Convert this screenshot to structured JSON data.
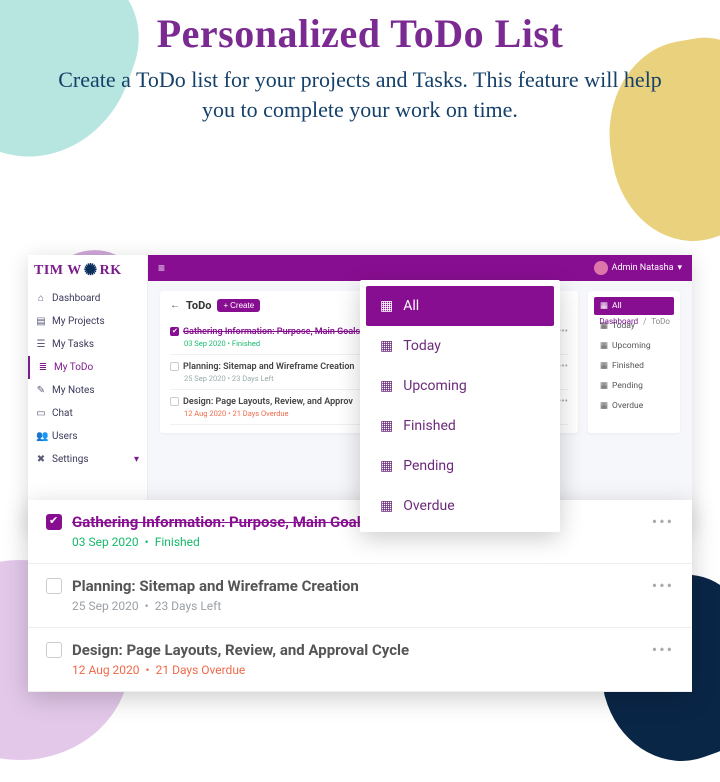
{
  "hero": {
    "title": "Personalized ToDo List",
    "subtitle": "Create a ToDo list for your projects and Tasks. This feature will help you to complete your work on time."
  },
  "brand": {
    "pre": "TIM W",
    "post": "RK"
  },
  "sidebar": {
    "items": [
      {
        "label": "Dashboard"
      },
      {
        "label": "My Projects"
      },
      {
        "label": "My Tasks"
      },
      {
        "label": "My ToDo"
      },
      {
        "label": "My Notes"
      },
      {
        "label": "Chat"
      },
      {
        "label": "Users"
      },
      {
        "label": "Settings"
      }
    ]
  },
  "topbar": {
    "user_name": "Admin Natasha"
  },
  "breadcrumb": {
    "root": "Dashboard",
    "sep": "/",
    "leaf": "ToDo"
  },
  "todo": {
    "heading": "ToDo",
    "create_label": "Create",
    "items": [
      {
        "title": "Gathering Information: Purpose, Main Goals",
        "date": "03 Sep 2020",
        "status": "Finished"
      },
      {
        "title": "Planning: Sitemap and Wireframe Creation",
        "date": "25 Sep 2020",
        "status": "23 Days Left"
      },
      {
        "title": "Design: Page Layouts, Review, and Approv",
        "date": "12 Aug 2020",
        "status": "21 Days Overdue"
      }
    ]
  },
  "filters": {
    "items": [
      {
        "label": "All"
      },
      {
        "label": "Today"
      },
      {
        "label": "Upcoming"
      },
      {
        "label": "Finished"
      },
      {
        "label": "Pending"
      },
      {
        "label": "Overdue"
      }
    ]
  },
  "dropdown": {
    "items": [
      {
        "label": "All"
      },
      {
        "label": "Today"
      },
      {
        "label": "Upcoming"
      },
      {
        "label": "Finished"
      },
      {
        "label": "Pending"
      },
      {
        "label": "Overdue"
      }
    ]
  },
  "zoom": {
    "items": [
      {
        "title": "Gathering Information: Purpose, Main Goals",
        "date": "03 Sep 2020",
        "status": "Finished"
      },
      {
        "title": "Planning: Sitemap and Wireframe Creation",
        "date": "25 Sep 2020",
        "status": "23 Days Left"
      },
      {
        "title": "Design: Page Layouts, Review, and Approval Cycle",
        "date": "12 Aug 2020",
        "status": "21 Days Overdue"
      }
    ]
  }
}
